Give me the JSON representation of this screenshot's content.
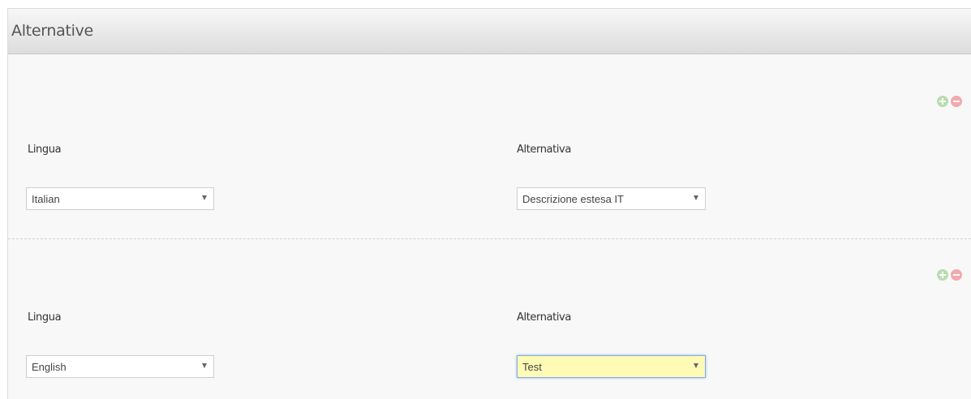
{
  "panel": {
    "title": "Alternative"
  },
  "icons": {
    "add": "plus-circle-icon",
    "remove": "minus-circle-icon"
  },
  "colors": {
    "add_icon": "#b8dcb0",
    "remove_icon": "#f2a9ad",
    "highlight_field": "#fffab5"
  },
  "rows": [
    {
      "language_label": "Lingua",
      "language_value": "Italian",
      "alternative_label": "Alternativa",
      "alternative_value": "Descrizione estesa IT"
    },
    {
      "language_label": "Lingua",
      "language_value": "English",
      "alternative_label": "Alternativa",
      "alternative_value": "Test"
    }
  ]
}
